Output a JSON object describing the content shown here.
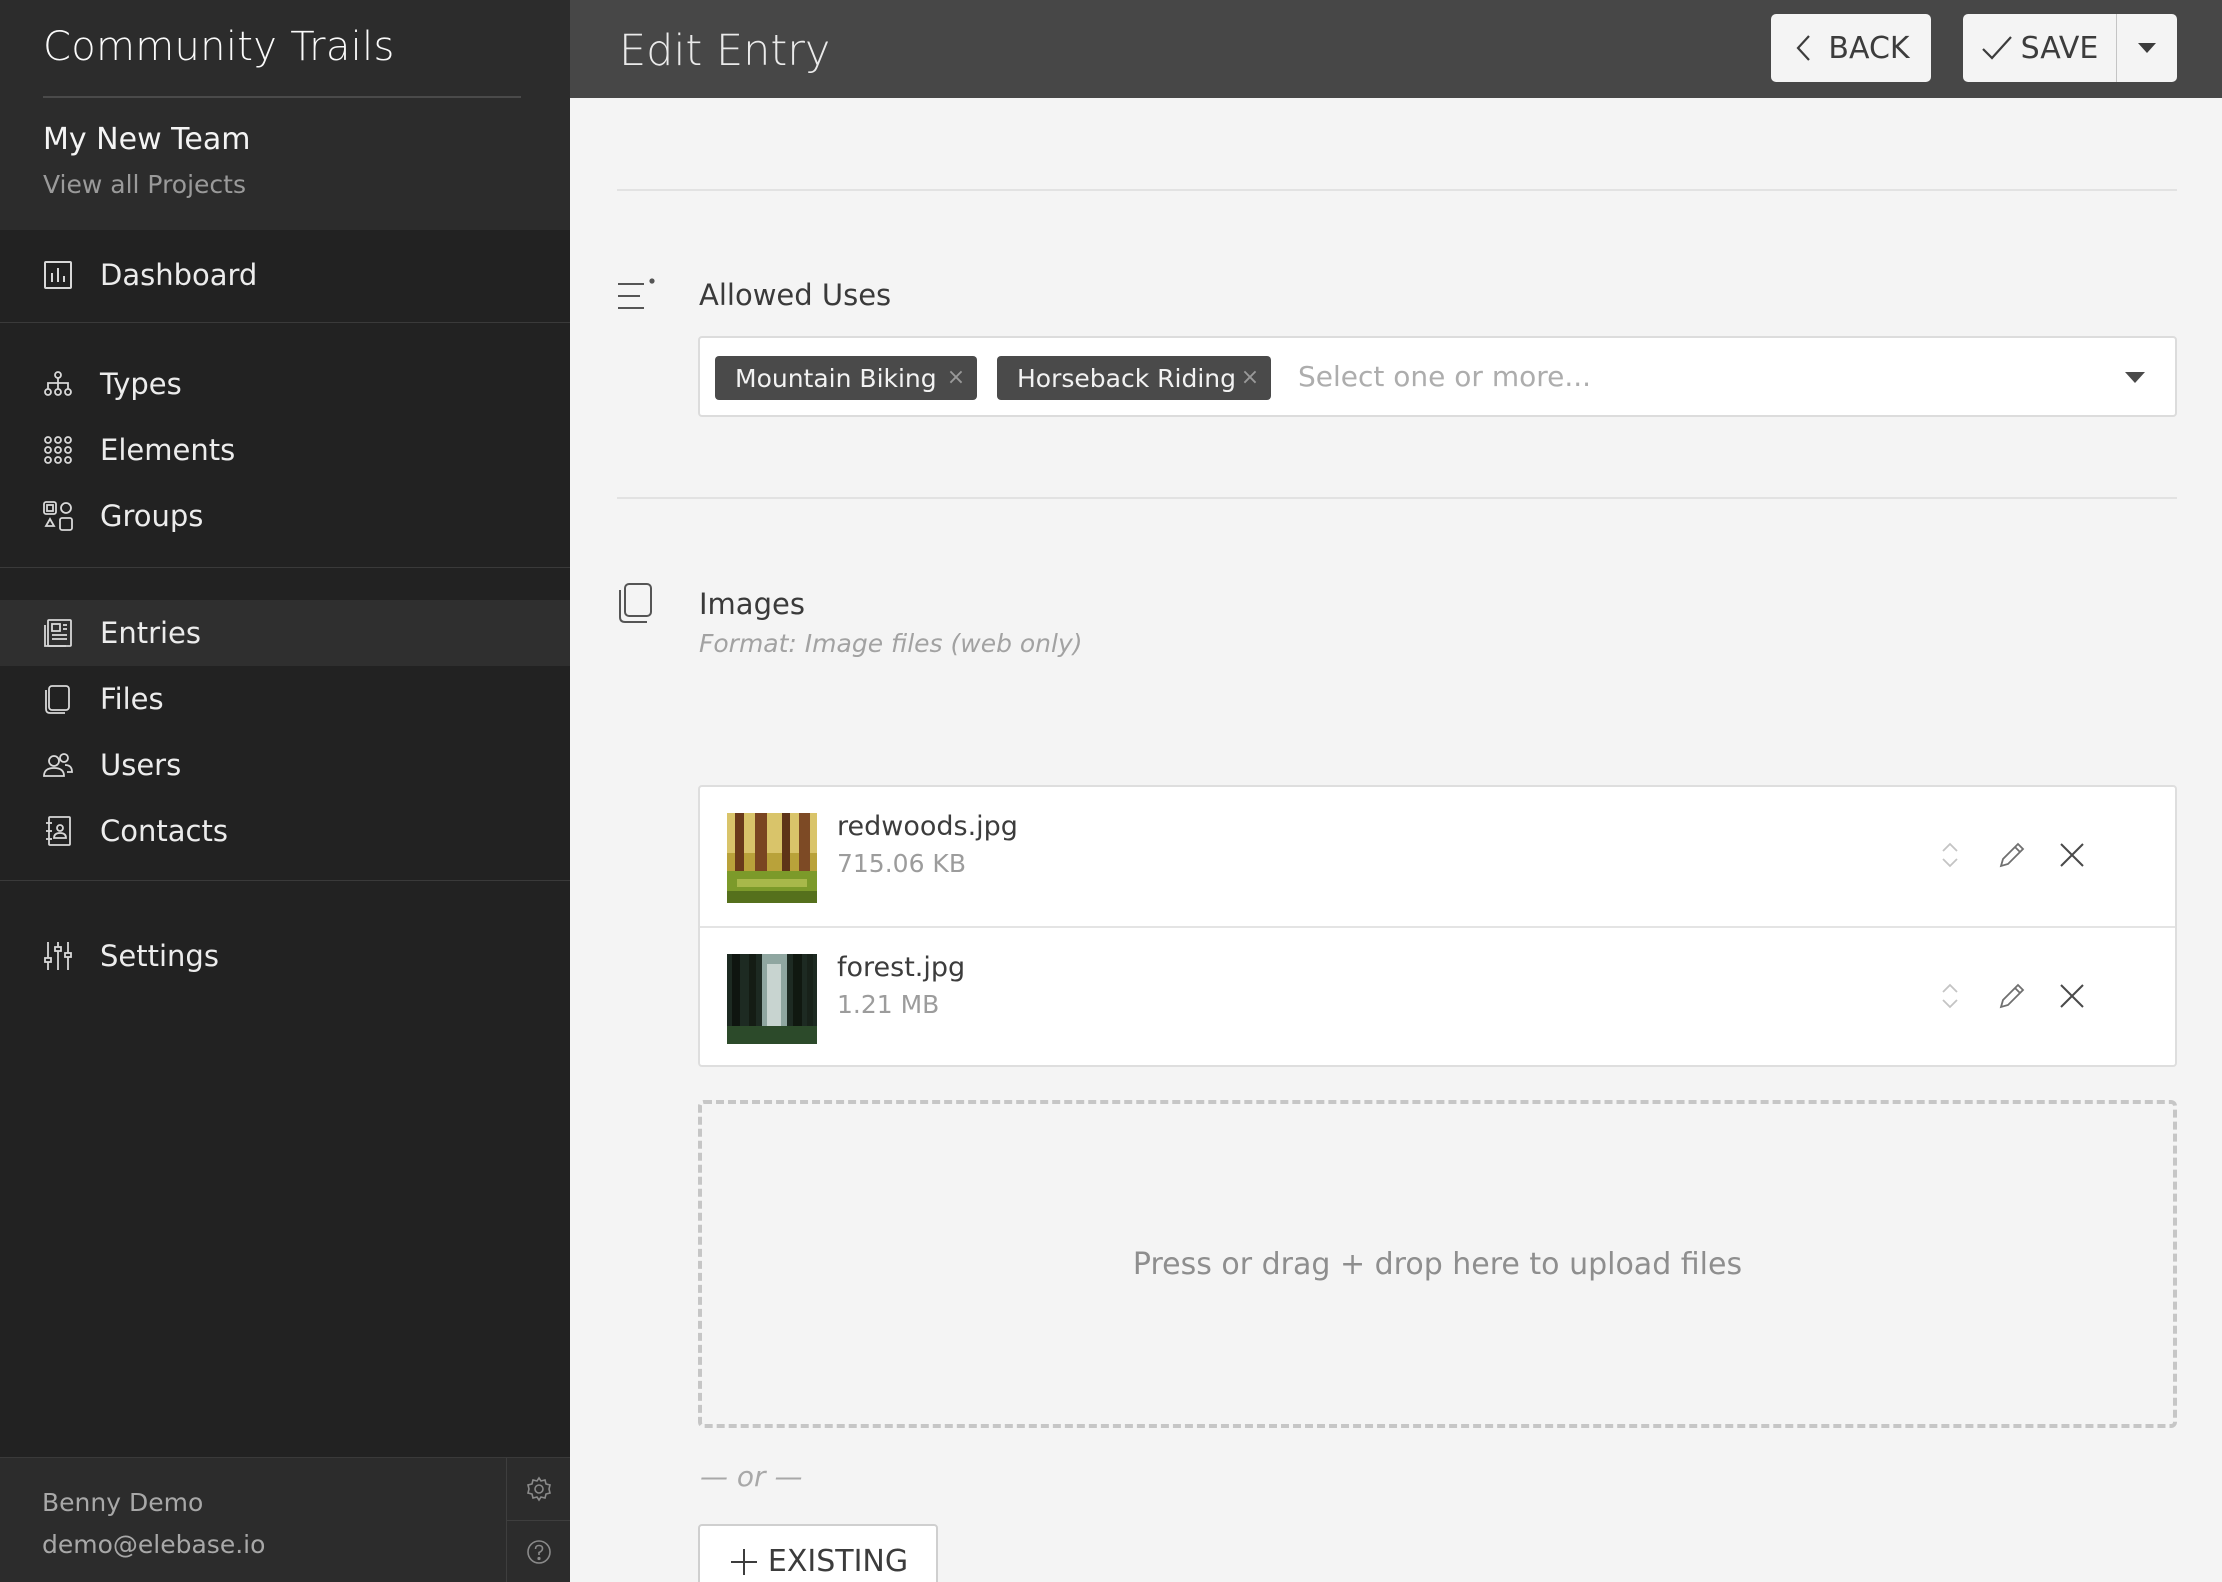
{
  "sidebar": {
    "app_title": "Community Trails",
    "team_name": "My New Team",
    "projects_link": "View all Projects",
    "nav_groups": [
      [
        {
          "label": "Dashboard",
          "icon": "dashboard-icon"
        }
      ],
      [
        {
          "label": "Types",
          "icon": "types-icon"
        },
        {
          "label": "Elements",
          "icon": "elements-icon"
        },
        {
          "label": "Groups",
          "icon": "groups-icon"
        }
      ],
      [
        {
          "label": "Entries",
          "icon": "entries-icon",
          "active": true
        },
        {
          "label": "Files",
          "icon": "files-icon"
        },
        {
          "label": "Users",
          "icon": "users-icon"
        },
        {
          "label": "Contacts",
          "icon": "contacts-icon"
        }
      ],
      [
        {
          "label": "Settings",
          "icon": "settings-icon"
        }
      ]
    ],
    "footer": {
      "user_name": "Benny Demo",
      "user_email": "demo@elebase.io",
      "buttons": [
        "gear-icon",
        "help-icon"
      ]
    }
  },
  "header": {
    "title": "Edit Entry",
    "back_label": "BACK",
    "save_label": "SAVE"
  },
  "allowed_uses": {
    "label": "Allowed Uses",
    "icon": "list-field-icon",
    "tags": [
      "Mountain Biking",
      "Horseback Riding"
    ],
    "placeholder": "Select one or more..."
  },
  "images": {
    "label": "Images",
    "icon": "files-field-icon",
    "format": "Format: Image files (web only)",
    "files": [
      {
        "name": "redwoods.jpg",
        "size": "715.06 KB"
      },
      {
        "name": "forest.jpg",
        "size": "1.21 MB"
      }
    ],
    "dropzone_text": "Press or drag + drop here to upload files",
    "or_text": "— or —",
    "existing_label": "EXISTING"
  },
  "colors": {
    "sidebar_bg": "#222222",
    "topbar_bg": "#474747",
    "content_bg": "#f4f4f4",
    "tag_bg": "#4a4a4a"
  }
}
